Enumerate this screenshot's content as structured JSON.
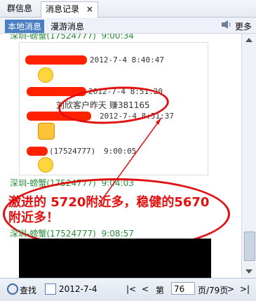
{
  "tabs": {
    "group": "群信息",
    "records": "消息记录",
    "close": "×"
  },
  "subbar": {
    "local": "本地消息",
    "roam": "漫游消息",
    "more": "更多"
  },
  "messages": [
    {
      "sender": "深圳-螃蟹(17524777)",
      "time": "9:00:34"
    },
    {
      "sender": "深圳-螃蟹(17524777)",
      "time": "9:04:03"
    },
    {
      "sender": "深圳-螃蟹(17524777)",
      "time": "9:08:57"
    }
  ],
  "screenshot_lines": [
    {
      "time": "2012-7-4 8:40:47"
    },
    {
      "time": "2012-7-4 8:51:20",
      "text": "刘欣客户昨天  赚381165"
    },
    {
      "time": "2012-7-4 8:51:37"
    },
    {
      "meta": "(17524777)",
      "time": "9:00:05"
    }
  ],
  "annotation": "激进的 5720附近多，稳健的5670附近多！",
  "bottom": {
    "find": "查找",
    "date": "2012-7-4",
    "page_label": "第",
    "page": "76",
    "total": "页/79页"
  }
}
